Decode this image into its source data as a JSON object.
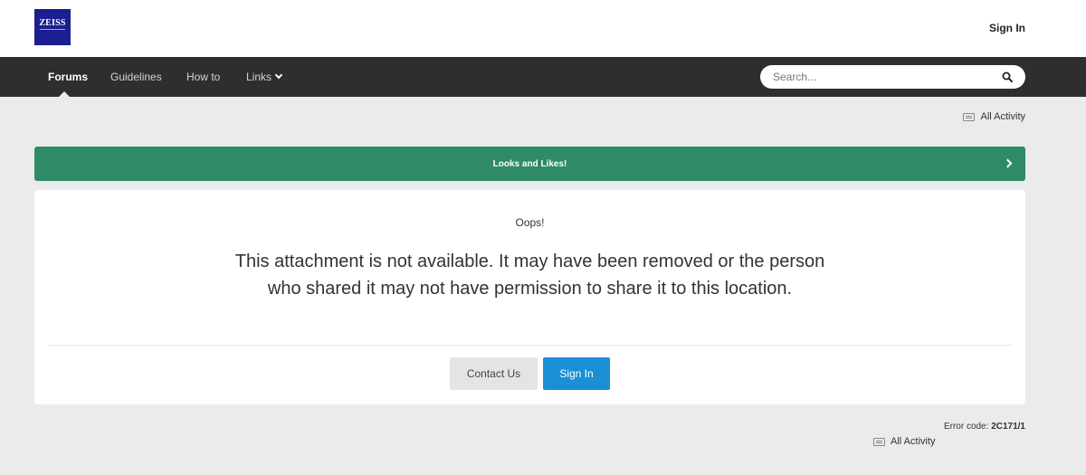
{
  "header": {
    "logo_text": "ZEISS",
    "sign_in_label": "Sign In"
  },
  "nav": {
    "items": [
      {
        "label": "Forums",
        "active": true
      },
      {
        "label": "Guidelines",
        "active": false
      },
      {
        "label": "How to",
        "active": false
      },
      {
        "label": "Links",
        "active": false
      }
    ],
    "search_placeholder": "Search..."
  },
  "activity": {
    "top_label": "All Activity",
    "bottom_label": "All Activity"
  },
  "banner": {
    "label": "Looks and Likes!",
    "color": "#2e8b66"
  },
  "error": {
    "oops": "Oops!",
    "message": "This attachment is not available. It may have been removed or the person who shared it may not have permission to share it to this location.",
    "contact_label": "Contact Us",
    "sign_in_label": "Sign In",
    "code_prefix": "Error code:",
    "code_value": "2C171/1"
  },
  "colors": {
    "accent": "#1a8fd6",
    "nav_background": "#2e2e2e",
    "logo_background": "#1b1f8f"
  },
  "icons": [
    "search-icon",
    "chevron-down-icon",
    "chevron-right-icon",
    "activity-icon"
  ]
}
